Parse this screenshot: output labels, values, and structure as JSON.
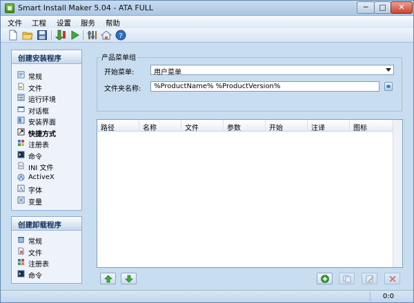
{
  "window": {
    "title": "Smart Install Maker 5.04 - ATA FULL",
    "min_label": "─",
    "max_label": "□",
    "close_label": "✕"
  },
  "menu": [
    {
      "label": "文件"
    },
    {
      "label": "工程"
    },
    {
      "label": "设置"
    },
    {
      "label": "服务"
    },
    {
      "label": "帮助"
    }
  ],
  "toolbar": {
    "icons": [
      "new-file-icon",
      "open-folder-icon",
      "save-icon",
      "build-icon",
      "run-icon",
      "settings-icon",
      "home-icon",
      "help-icon"
    ]
  },
  "install_group": {
    "title": "创建安装程序",
    "items": [
      {
        "label": "常规",
        "icon": "general-icon"
      },
      {
        "label": "文件",
        "icon": "files-icon"
      },
      {
        "label": "运行环境",
        "icon": "requirements-icon"
      },
      {
        "label": "对话框",
        "icon": "dialogs-icon"
      },
      {
        "label": "安装界面",
        "icon": "interface-icon"
      },
      {
        "label": "快捷方式",
        "icon": "shortcut-icon",
        "active": true
      },
      {
        "label": "注册表",
        "icon": "registry-icon"
      },
      {
        "label": "命令",
        "icon": "command-icon"
      },
      {
        "label": "INI 文件",
        "icon": "ini-file-icon"
      },
      {
        "label": "ActiveX",
        "icon": "activex-icon"
      },
      {
        "label": "字体",
        "icon": "font-icon"
      },
      {
        "label": "变量",
        "icon": "variables-icon"
      }
    ]
  },
  "uninstall_group": {
    "title": "创建卸载程序",
    "items": [
      {
        "label": "常规",
        "icon": "trash-icon"
      },
      {
        "label": "文件",
        "icon": "delete-files-icon"
      },
      {
        "label": "注册表",
        "icon": "registry-delete-icon"
      },
      {
        "label": "命令",
        "icon": "command-icon"
      }
    ]
  },
  "product_group": {
    "title": "产品菜单组",
    "start_menu_label": "开始菜单:",
    "start_menu_value": "用户菜单",
    "folder_name_label": "文件夹名称:",
    "folder_name_value": "%ProductName% %ProductVersion%"
  },
  "table": {
    "columns": [
      "路径",
      "名称",
      "文件",
      "参数",
      "开始",
      "注译",
      "图标"
    ],
    "rows": []
  },
  "status": {
    "text": "0:0"
  },
  "colors": {
    "window_bg": "#c9ddf0",
    "accent": "#15325c"
  }
}
